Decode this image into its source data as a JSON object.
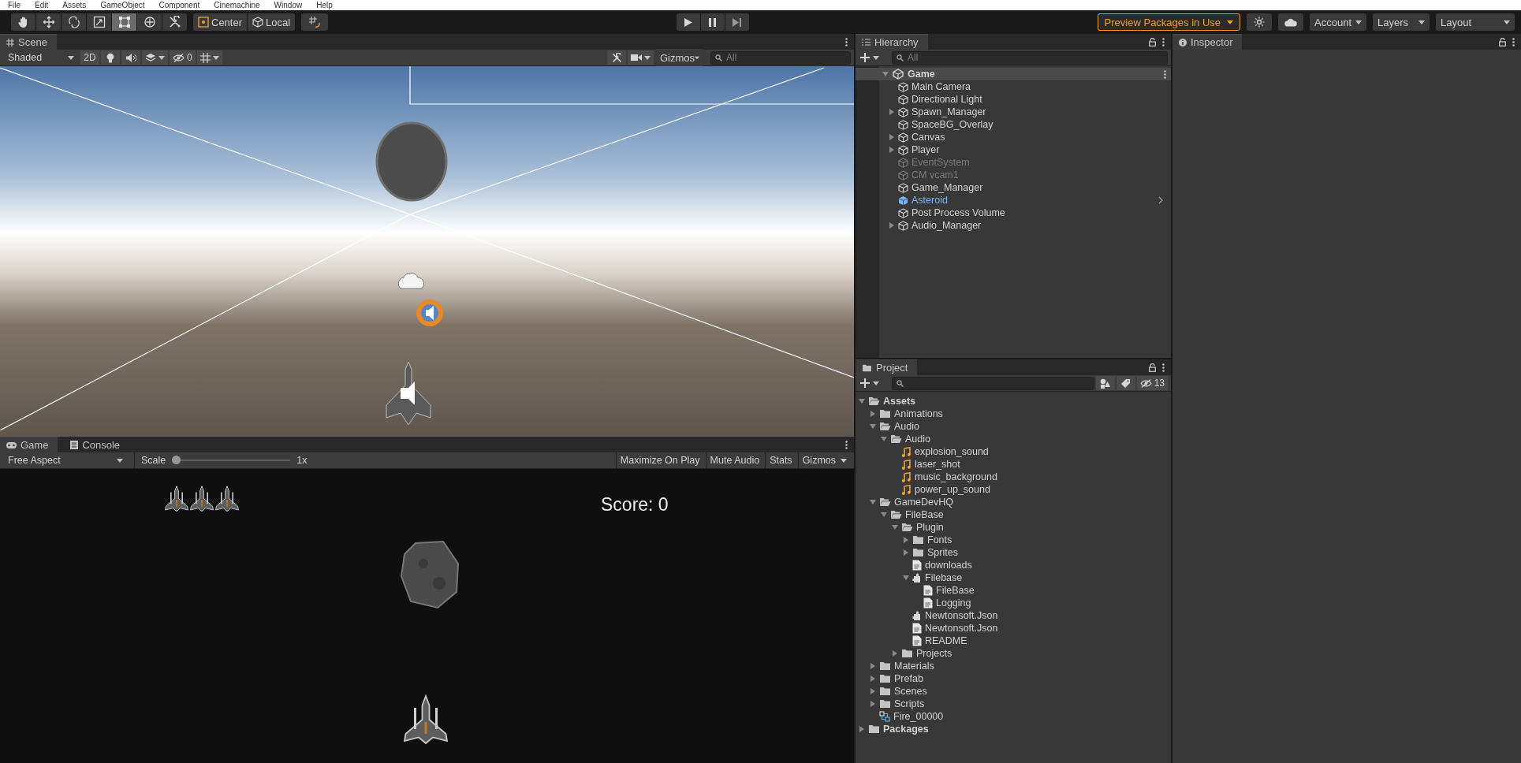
{
  "menu_bar": [
    "File",
    "Edit",
    "Assets",
    "GameObject",
    "Component",
    "Cinemachine",
    "Window",
    "Help"
  ],
  "toolbar": {
    "tools": [
      {
        "kind": "hand",
        "selected": false
      },
      {
        "kind": "move",
        "selected": false
      },
      {
        "kind": "rotate",
        "selected": false
      },
      {
        "kind": "scale",
        "selected": false
      },
      {
        "kind": "rect",
        "selected": true
      },
      {
        "kind": "transform",
        "selected": false
      },
      {
        "kind": "custom",
        "selected": false
      }
    ],
    "pivot_buttons": [
      "Center",
      "Local"
    ],
    "preview_packages": "Preview Packages in Use",
    "account": "Account",
    "layers": "Layers",
    "layout": "Layout"
  },
  "scene": {
    "tab": "Scene",
    "shading": "Shaded",
    "mode_2d": "2D",
    "hidden_count": "0",
    "gizmos": "Gizmos",
    "search_placeholder": "All"
  },
  "game": {
    "tabs": [
      {
        "label": "Game",
        "kind": "game",
        "selected": true
      },
      {
        "label": "Console",
        "kind": "console",
        "selected": false
      }
    ],
    "aspect": "Free Aspect",
    "scale_label": "Scale",
    "scale": {
      "level": 0
    },
    "scale_value": "1x",
    "buttons": [
      "Maximize On Play",
      "Mute Audio",
      "Stats",
      "Gizmos"
    ],
    "score": "Score: 0"
  },
  "hierarchy": {
    "title": "Hierarchy",
    "search_placeholder": "All",
    "scene": {
      "name": "Game",
      "expanded": true
    },
    "items": [
      {
        "name": "Main Camera",
        "kind": "object",
        "expandable": false,
        "active": true
      },
      {
        "name": "Directional Light",
        "kind": "object",
        "expandable": false,
        "active": true
      },
      {
        "name": "Spawn_Manager",
        "kind": "object",
        "expandable": true,
        "active": true
      },
      {
        "name": "SpaceBG_Overlay",
        "kind": "object",
        "expandable": false,
        "active": true
      },
      {
        "name": "Canvas",
        "kind": "object",
        "expandable": true,
        "active": true
      },
      {
        "name": "Player",
        "kind": "object",
        "expandable": true,
        "active": true
      },
      {
        "name": "EventSystem",
        "kind": "object",
        "expandable": false,
        "active": false
      },
      {
        "name": "CM vcam1",
        "kind": "object",
        "expandable": false,
        "active": false
      },
      {
        "name": "Game_Manager",
        "kind": "object",
        "expandable": false,
        "active": true
      },
      {
        "name": "Asteroid",
        "kind": "prefab",
        "expandable": false,
        "active": true
      },
      {
        "name": "Post Process Volume",
        "kind": "object",
        "expandable": false,
        "active": true
      },
      {
        "name": "Audio_Manager",
        "kind": "object",
        "expandable": true,
        "active": true
      }
    ]
  },
  "project": {
    "title": "Project",
    "hidden_count": "13",
    "tree": [
      {
        "name": "Assets",
        "kind": "folder",
        "expanded": true,
        "children": [
          {
            "name": "Animations",
            "kind": "folder",
            "expanded": false
          },
          {
            "name": "Audio",
            "kind": "folder",
            "expanded": true,
            "children": [
              {
                "name": "Audio",
                "kind": "folder",
                "expanded": true,
                "children": [
                  {
                    "name": "explosion_sound",
                    "kind": "audio"
                  },
                  {
                    "name": "laser_shot",
                    "kind": "audio"
                  },
                  {
                    "name": "music_background",
                    "kind": "audio"
                  },
                  {
                    "name": "power_up_sound",
                    "kind": "audio"
                  }
                ]
              }
            ]
          },
          {
            "name": "GameDevHQ",
            "kind": "folder",
            "expanded": true,
            "children": [
              {
                "name": "FileBase",
                "kind": "folder",
                "expanded": true,
                "children": [
                  {
                    "name": "Plugin",
                    "kind": "folder",
                    "expanded": true,
                    "children": [
                      {
                        "name": "Fonts",
                        "kind": "folder",
                        "expanded": false
                      },
                      {
                        "name": "Sprites",
                        "kind": "folder",
                        "expanded": false
                      },
                      {
                        "name": "downloads",
                        "kind": "text"
                      },
                      {
                        "name": "Filebase",
                        "kind": "assembly",
                        "expanded": true,
                        "children": [
                          {
                            "name": "FileBase",
                            "kind": "text"
                          },
                          {
                            "name": "Logging",
                            "kind": "text"
                          }
                        ]
                      },
                      {
                        "name": "Newtonsoft.Json",
                        "kind": "assembly"
                      },
                      {
                        "name": "Newtonsoft.Json",
                        "kind": "text"
                      },
                      {
                        "name": "README",
                        "kind": "text"
                      }
                    ]
                  },
                  {
                    "name": "Projects",
                    "kind": "folder",
                    "expanded": false
                  }
                ]
              }
            ]
          },
          {
            "name": "Materials",
            "kind": "folder",
            "expanded": false
          },
          {
            "name": "Prefab",
            "kind": "folder",
            "expanded": false
          },
          {
            "name": "Scenes",
            "kind": "folder",
            "expanded": false
          },
          {
            "name": "Scripts",
            "kind": "folder",
            "expanded": false
          },
          {
            "name": "Fire_00000",
            "kind": "animation"
          }
        ]
      },
      {
        "name": "Packages",
        "kind": "folder",
        "expanded": false
      }
    ]
  },
  "inspector": {
    "title": "Inspector"
  }
}
